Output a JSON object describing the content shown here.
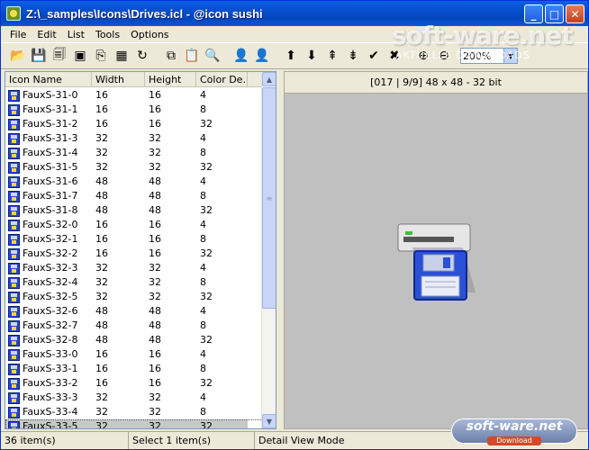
{
  "window": {
    "title": "Z:\\_samples\\Icons\\Drives.icl - @icon sushi",
    "minimize_glyph": "_",
    "maximize_glyph": "□",
    "close_glyph": "✕"
  },
  "menu": [
    "File",
    "Edit",
    "List",
    "Tools",
    "Options"
  ],
  "toolbar": {
    "zoom_value": "200%",
    "tools": [
      {
        "name": "open-folder-icon",
        "glyph": "📂"
      },
      {
        "name": "save-icon",
        "glyph": "💾"
      },
      {
        "name": "save-all-icon",
        "glyph": "🗐"
      },
      {
        "name": "export-icon",
        "glyph": "▣"
      },
      {
        "name": "extract-icon",
        "glyph": "⎘"
      },
      {
        "name": "bmp-export-icon",
        "glyph": "▦"
      },
      {
        "name": "refresh-icon",
        "glyph": "↻"
      },
      {
        "name": "copy-icon",
        "glyph": "⧉"
      },
      {
        "name": "paste-icon",
        "glyph": "📋"
      },
      {
        "name": "find-icon",
        "glyph": "🔍"
      },
      {
        "name": "user-icon",
        "glyph": "👤"
      },
      {
        "name": "user-green-icon",
        "glyph": "👤"
      },
      {
        "name": "arrow-up-icon",
        "glyph": "⬆"
      },
      {
        "name": "arrow-down-icon",
        "glyph": "⬇"
      },
      {
        "name": "move-top-icon",
        "glyph": "⇞"
      },
      {
        "name": "move-bottom-icon",
        "glyph": "⇟"
      },
      {
        "name": "check-icon",
        "glyph": "✔"
      },
      {
        "name": "delete-icon",
        "glyph": "✖"
      },
      {
        "name": "zoom-in-icon",
        "glyph": "⊕"
      },
      {
        "name": "zoom-out-icon",
        "glyph": "⊖"
      }
    ]
  },
  "list": {
    "columns": [
      "Icon Name",
      "Width",
      "Height",
      "Color De..."
    ],
    "selected_index": 23,
    "rows": [
      [
        "FauxS-31-0",
        "16",
        "16",
        "4"
      ],
      [
        "FauxS-31-1",
        "16",
        "16",
        "8"
      ],
      [
        "FauxS-31-2",
        "16",
        "16",
        "32"
      ],
      [
        "FauxS-31-3",
        "32",
        "32",
        "4"
      ],
      [
        "FauxS-31-4",
        "32",
        "32",
        "8"
      ],
      [
        "FauxS-31-5",
        "32",
        "32",
        "32"
      ],
      [
        "FauxS-31-6",
        "48",
        "48",
        "4"
      ],
      [
        "FauxS-31-7",
        "48",
        "48",
        "8"
      ],
      [
        "FauxS-31-8",
        "48",
        "48",
        "32"
      ],
      [
        "FauxS-32-0",
        "16",
        "16",
        "4"
      ],
      [
        "FauxS-32-1",
        "16",
        "16",
        "8"
      ],
      [
        "FauxS-32-2",
        "16",
        "16",
        "32"
      ],
      [
        "FauxS-32-3",
        "32",
        "32",
        "4"
      ],
      [
        "FauxS-32-4",
        "32",
        "32",
        "8"
      ],
      [
        "FauxS-32-5",
        "32",
        "32",
        "32"
      ],
      [
        "FauxS-32-6",
        "48",
        "48",
        "4"
      ],
      [
        "FauxS-32-7",
        "48",
        "48",
        "8"
      ],
      [
        "FauxS-32-8",
        "48",
        "48",
        "32"
      ],
      [
        "FauxS-33-0",
        "16",
        "16",
        "4"
      ],
      [
        "FauxS-33-1",
        "16",
        "16",
        "8"
      ],
      [
        "FauxS-33-2",
        "16",
        "16",
        "32"
      ],
      [
        "FauxS-33-3",
        "32",
        "32",
        "4"
      ],
      [
        "FauxS-33-4",
        "32",
        "32",
        "8"
      ],
      [
        "FauxS-33-5",
        "32",
        "32",
        "32"
      ]
    ]
  },
  "preview": {
    "info": "[017 | 9/9] 48 x 48 - 32 bit"
  },
  "status": {
    "items": "36 item(s)",
    "selected": "Select 1 item(s)",
    "mode": "Detail View Mode"
  },
  "watermark": {
    "brand": "soft-ware.net",
    "subtitle": "AKTUELLE DOWNLOADS",
    "bottom_brand": "soft-ware.net",
    "bottom_download": "Download"
  },
  "colors": {
    "titlebar": "#0851d0",
    "selected_row": "#c7c8c9",
    "preview_bg": "#c0c0c0"
  }
}
